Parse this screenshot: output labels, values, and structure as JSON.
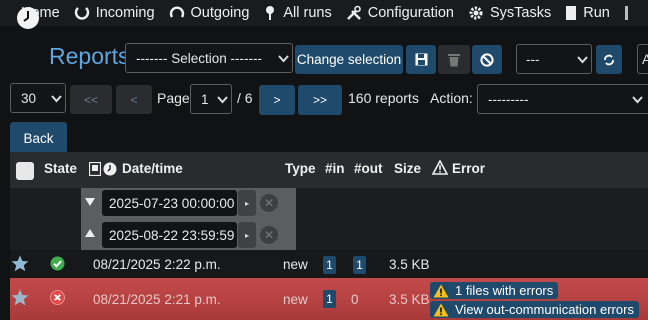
{
  "nav": {
    "items": [
      {
        "label": "Home",
        "icon": "none"
      },
      {
        "label": "Incoming",
        "icon": "incoming-icon"
      },
      {
        "label": "Outgoing",
        "icon": "outgoing-icon"
      },
      {
        "label": "All runs",
        "icon": "pin-icon"
      },
      {
        "label": "Configuration",
        "icon": "tools-icon"
      },
      {
        "label": "SysTasks",
        "icon": "gear-icon"
      },
      {
        "label": "Run",
        "icon": "document-icon"
      }
    ]
  },
  "page": {
    "title": "Reports",
    "selection_value": "------- Selection -------",
    "change_selection_label": "Change selection",
    "dash_select_value": "---"
  },
  "pager": {
    "rows_per_page": "30",
    "first_label": "<<",
    "prev_label": "<",
    "page_label": "Page",
    "page_value": "1",
    "total_pages": "/ 6",
    "next_label": ">",
    "last_label": ">>",
    "count_text": "160 reports",
    "action_label": "Action:",
    "action_value": "---------"
  },
  "back_label": "Back",
  "table": {
    "headers": {
      "state": "State",
      "datetime": "Date/time",
      "type": "Type",
      "in": "#in",
      "out": "#out",
      "size": "Size",
      "error": "Error"
    },
    "filter": {
      "date_from": "2025-07-23 00:00:00",
      "date_to": "2025-08-22 23:59:59"
    },
    "rows": [
      {
        "state": "ok",
        "datetime": "08/21/2025  2:22 p.m.",
        "type": "new",
        "in": "1",
        "out": "1",
        "size": "3.5 KB",
        "errors": []
      },
      {
        "state": "error",
        "datetime": "08/21/2025  2:21 p.m.",
        "type": "new",
        "in": "1",
        "out": "0",
        "size": "3.5 KB",
        "errors": [
          "1 files with errors",
          "View out-communication errors"
        ]
      }
    ]
  },
  "colors": {
    "accent": "#5fa6e0",
    "button": "#1f4a6b",
    "ok": "#3fae4e",
    "error_row": "#b84343"
  }
}
